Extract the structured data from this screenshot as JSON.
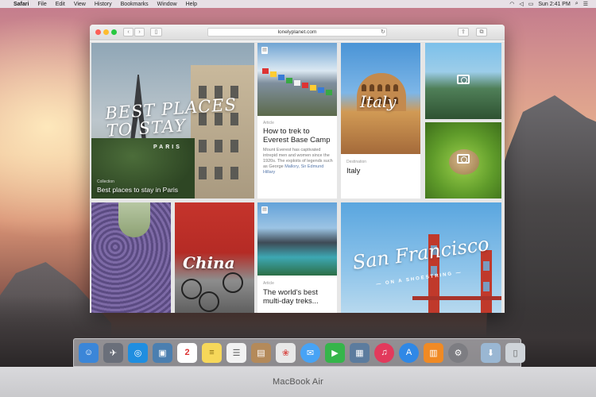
{
  "menubar": {
    "apple_glyph": "",
    "app_name": "Safari",
    "menus": [
      "File",
      "Edit",
      "View",
      "History",
      "Bookmarks",
      "Window",
      "Help"
    ],
    "clock": "Sun 2:41 PM"
  },
  "browser": {
    "url": "lonelyplanet.com",
    "back_glyph": "‹",
    "forward_glyph": "›"
  },
  "cards": {
    "paris": {
      "script_title": "BEST PLACES TO STAY",
      "subtitle": "PARIS",
      "category": "Collection",
      "title": "Best places to stay in Paris"
    },
    "everest": {
      "category": "Article",
      "title": "How to trek to Everest Base Camp",
      "snippet": "Mount Everest has captivated intrepid men and women since the 1920s. The exploits of legends such as George",
      "snippet_more": "Mallory, Sir Edmund Hillary"
    },
    "italy": {
      "script_title": "Italy",
      "category": "Destination",
      "title": "Italy"
    },
    "china": {
      "script_title": "China"
    },
    "treks": {
      "category": "Article",
      "title": "The world's best multi-day treks..."
    },
    "sf": {
      "script_title": "San Francisco",
      "subtitle": "— ON A SHOESTRING —"
    }
  },
  "dock": {
    "calendar_day": "2",
    "apps": [
      {
        "name": "finder",
        "color": "#3b86d8",
        "glyph": "☺"
      },
      {
        "name": "launchpad",
        "color": "#6a6f7a",
        "glyph": "✈"
      },
      {
        "name": "safari",
        "color": "#1f8ee0",
        "glyph": "◎"
      },
      {
        "name": "preview",
        "color": "#4b7fb0",
        "glyph": "▣"
      },
      {
        "name": "calendar",
        "color": "#ffffff",
        "glyph": "2"
      },
      {
        "name": "notes",
        "color": "#f6d75a",
        "glyph": "≡"
      },
      {
        "name": "reminders",
        "color": "#f2f2f2",
        "glyph": "☰"
      },
      {
        "name": "contacts",
        "color": "#b48a5a",
        "glyph": "▤"
      },
      {
        "name": "photos",
        "color": "#e8e8e8",
        "glyph": "❀"
      },
      {
        "name": "messages",
        "color": "#47a3f5",
        "glyph": "✉"
      },
      {
        "name": "facetime",
        "color": "#35b54a",
        "glyph": "▶"
      },
      {
        "name": "iphoto",
        "color": "#5c7c9e",
        "glyph": "▦"
      },
      {
        "name": "itunes",
        "color": "#e23a5c",
        "glyph": "♫"
      },
      {
        "name": "app-store",
        "color": "#2f88e6",
        "glyph": "A"
      },
      {
        "name": "ibooks",
        "color": "#f08a24",
        "glyph": "▥"
      },
      {
        "name": "system-preferences",
        "color": "#7d7d82",
        "glyph": "⚙"
      },
      {
        "name": "downloads",
        "color": "#9ab7d3",
        "glyph": "⬇"
      },
      {
        "name": "trash",
        "color": "#cfd4d9",
        "glyph": "🗑"
      }
    ]
  },
  "device": {
    "label": "MacBook Air"
  }
}
